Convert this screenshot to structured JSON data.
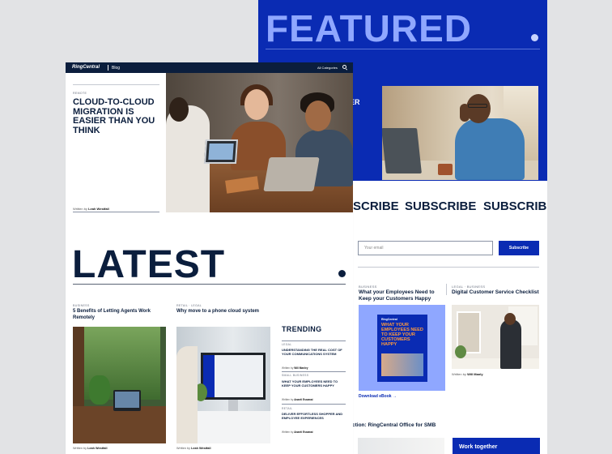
{
  "featured": {
    "title": "FEATURED",
    "title_dot": ".",
    "partial_text": "ER"
  },
  "subscribe": {
    "words": [
      "SCRIBE",
      "SUBSCRIBE",
      "SUBSCRIBE"
    ],
    "email_placeholder": "Your email",
    "button_label": "Subscribe"
  },
  "back_posts": [
    {
      "category": "BUSINESS",
      "title": "What your Employees Need to Keep your Customers Happy"
    },
    {
      "category": "LEGAL · BUSINESS",
      "title": "Digital Customer Service Checklist"
    }
  ],
  "ebook": {
    "logo": "RingCentral",
    "cover_text": "WHAT YOUR EMPLOYEES NEED TO KEEP YOUR CUSTOMERS HAPPY",
    "link": "Download eBook →"
  },
  "back_written": {
    "prefix": "Written by",
    "author": "Will Manly"
  },
  "collection": {
    "category": "",
    "title": "ction: RingCentral Office for SMB"
  },
  "work_card": {
    "title": "Work together"
  },
  "nav": {
    "logo": "RingCentral",
    "section": "Blog",
    "categories": "All Categories"
  },
  "hero": {
    "category": "REMOTE",
    "title": "CLOUD-TO-CLOUD MIGRATION IS EASIER THAN YOU THINK",
    "written_prefix": "Written by",
    "author": "Leah Westfall"
  },
  "latest": {
    "title": "LATEST",
    "dot": ".",
    "cards": [
      {
        "category": "BUSINESS",
        "title": "5 Benefits of Letting Agents Work Remotely",
        "written_prefix": "Written by",
        "author": "Leah Westfall"
      },
      {
        "category": "RETAIL · LEGAL",
        "title": "Why move to a phone cloud system",
        "written_prefix": "Written by",
        "author": "Leah Westfall"
      }
    ]
  },
  "trending": {
    "title": "TRENDING",
    "items": [
      {
        "category": "LEGAL",
        "title": "UNDERSTANDING THE REAL COST OF YOUR COMMUNICATIONS SYSTEM",
        "written_prefix": "Written by",
        "author": "Will Manley"
      },
      {
        "category": "SMALL BUSINESS",
        "title": "WHAT YOUR EMPLOYEES NEED TO KEEP YOUR CUSTOMERS HAPPY",
        "written_prefix": "Written by",
        "author": "Ananti Essawai"
      },
      {
        "category": "RETAIL",
        "title": "DELIVER EFFORTLESS SHOPPER AND EMPLOYEE EXPERIENCES",
        "written_prefix": "Written by",
        "author": "Ananti Essawai"
      }
    ]
  },
  "colors": {
    "navy": "#0b1e3d",
    "brand_blue": "#0a2bb3",
    "light_blue": "#8fa7ff"
  }
}
